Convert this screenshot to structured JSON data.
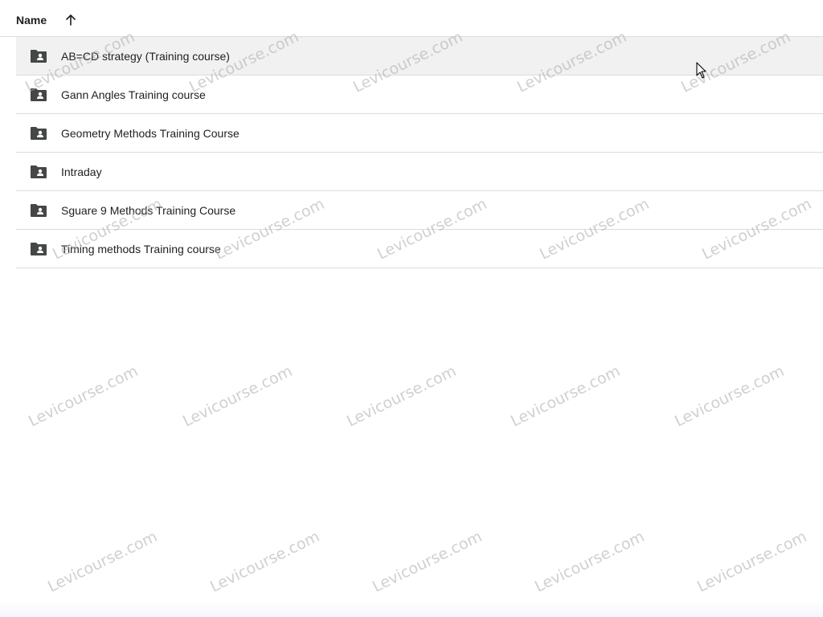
{
  "header": {
    "name_label": "Name",
    "sort_icon": "arrow-up-icon"
  },
  "files": [
    {
      "name": "AB=CD strategy (Training course)",
      "icon": "shared-folder-icon",
      "selected": true
    },
    {
      "name": "Gann Angles Training course",
      "icon": "shared-folder-icon",
      "selected": false
    },
    {
      "name": "Geometry Methods Training Course",
      "icon": "shared-folder-icon",
      "selected": false
    },
    {
      "name": "Intraday",
      "icon": "shared-folder-icon",
      "selected": false
    },
    {
      "name": "Sguare 9 Methods Training Course",
      "icon": "shared-folder-icon",
      "selected": false
    },
    {
      "name": "Timing methods Training course",
      "icon": "shared-folder-icon",
      "selected": false
    }
  ],
  "watermark": {
    "text": "Levicourse.com"
  },
  "colors": {
    "selected_row": "#f1f1f1",
    "divider": "#dadce0",
    "icon": "#444746",
    "text": "#1f1f1f"
  }
}
